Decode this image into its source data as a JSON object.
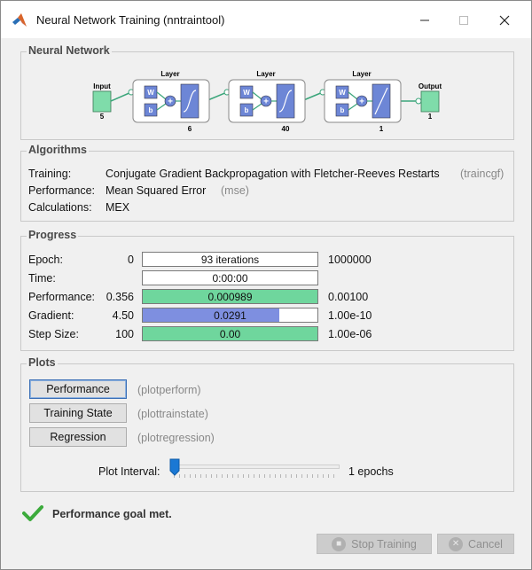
{
  "window": {
    "title": "Neural Network Training (nntraintool)"
  },
  "network": {
    "group_title": "Neural Network",
    "input_label": "Input",
    "input_size": "5",
    "output_label": "Output",
    "output_size": "1",
    "weight_label": "W",
    "bias_label": "b",
    "layer_label": "Layer",
    "layers": [
      {
        "label": "Layer",
        "size": "6"
      },
      {
        "label": "Layer",
        "size": "40"
      },
      {
        "label": "Layer",
        "size": "1"
      }
    ]
  },
  "algorithms": {
    "group_title": "Algorithms",
    "training_label": "Training:",
    "training_value": "Conjugate Gradient Backpropagation with Fletcher-Reeves Restarts",
    "training_code": "(traincgf)",
    "performance_label": "Performance:",
    "performance_value": "Mean Squared Error",
    "performance_code": "(mse)",
    "calculations_label": "Calculations:",
    "calculations_value": "MEX"
  },
  "progress": {
    "group_title": "Progress",
    "rows": [
      {
        "label": "Epoch:",
        "start": "0",
        "bar_text": "93 iterations",
        "end": "1000000",
        "fill": 0,
        "color": "#ffffff"
      },
      {
        "label": "Time:",
        "start": "",
        "bar_text": "0:00:00",
        "end": "",
        "fill": 0,
        "color": "#ffffff"
      },
      {
        "label": "Performance:",
        "start": "0.356",
        "bar_text": "0.000989",
        "end": "0.00100",
        "fill": 1.0,
        "color": "#6fd69d"
      },
      {
        "label": "Gradient:",
        "start": "4.50",
        "bar_text": "0.0291",
        "end": "1.00e-10",
        "fill": 0.78,
        "color": "#7e8fe0"
      },
      {
        "label": "Step Size:",
        "start": "100",
        "bar_text": "0.00",
        "end": "1.00e-06",
        "fill": 1.0,
        "color": "#6fd69d"
      }
    ]
  },
  "plots": {
    "group_title": "Plots",
    "buttons": [
      {
        "label": "Performance",
        "code": "(plotperform)"
      },
      {
        "label": "Training State",
        "code": "(plottrainstate)"
      },
      {
        "label": "Regression",
        "code": "(plotregression)"
      }
    ],
    "interval_label": "Plot Interval:",
    "interval_value": "1 epochs"
  },
  "status": {
    "text": "Performance goal met.",
    "color": "#3cab3c"
  },
  "footer": {
    "stop_label": "Stop Training",
    "cancel_label": "Cancel"
  }
}
